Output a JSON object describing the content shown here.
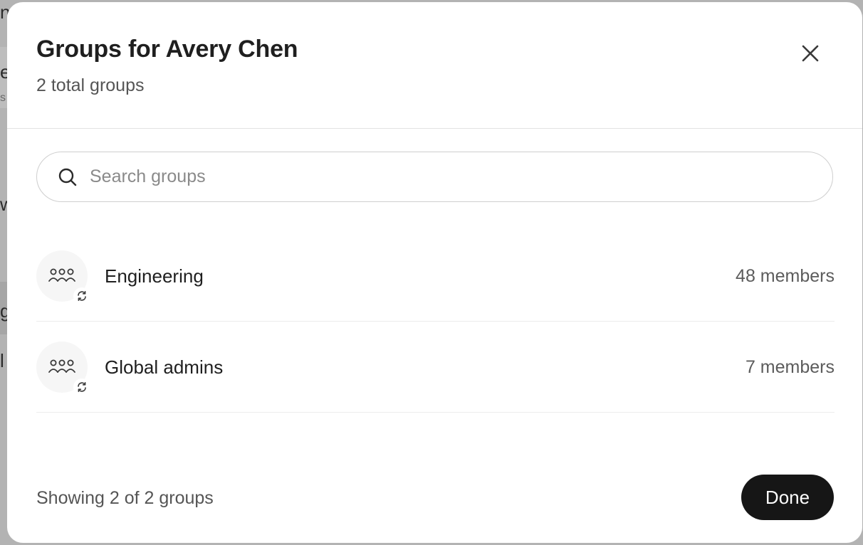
{
  "dialog": {
    "title": "Groups for Avery Chen",
    "subtitle": "2 total groups",
    "close_icon": "close-icon"
  },
  "search": {
    "placeholder": "Search groups",
    "value": "",
    "icon": "search-icon"
  },
  "groups": [
    {
      "name": "Engineering",
      "members": "48 members",
      "icon": "people-icon",
      "badge_icon": "sync-icon"
    },
    {
      "name": "Global admins",
      "members": "7 members",
      "icon": "people-icon",
      "badge_icon": "sync-icon"
    }
  ],
  "footer": {
    "status": "Showing 2 of 2 groups",
    "done_label": "Done"
  },
  "backdrop": {
    "fragments": [
      "n",
      "e",
      "s",
      "w",
      "g",
      "l"
    ]
  },
  "colors": {
    "overlay": "#a9a9a9",
    "dialog_bg": "#ffffff",
    "primary_button": "#161616",
    "primary_text": "#1f1f1f",
    "secondary_text": "#555555",
    "border": "#cfcfcf"
  }
}
